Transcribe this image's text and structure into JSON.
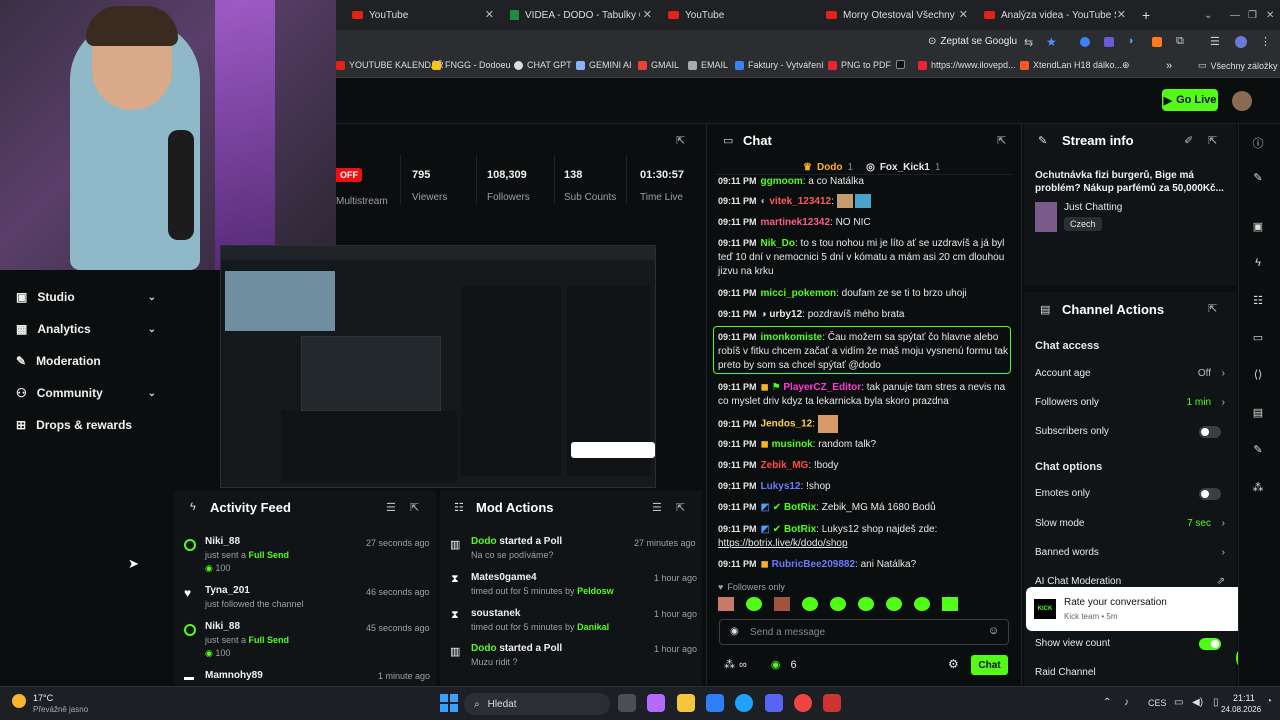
{
  "browser": {
    "tabs": [
      {
        "label": "YouTube",
        "icon": "youtube-icon"
      },
      {
        "label": "VIDEA - DODO - Tabulky Goog",
        "icon": "sheets-icon"
      },
      {
        "label": "YouTube",
        "icon": "youtube-icon"
      },
      {
        "label": "Morry Otestoval Všechny Věc",
        "icon": "youtube-icon"
      },
      {
        "label": "Analýza videa - YouTube Studio",
        "icon": "youtube-icon"
      }
    ],
    "new_tab": "+",
    "ask_google": "Zeptat se Googlu",
    "bookmarks": [
      "YOUTUBE KALENDÁŘ",
      "FNGG - Dodoeu",
      "CHAT GPT",
      "GEMINI AI",
      "GMAIL",
      "EMAIL",
      "Faktury - Vytváření",
      "PNG to PDF",
      "https://www.ilovepd...",
      "XtendLan H18 dálko..."
    ],
    "all_bookmarks": "Všechny záložky"
  },
  "top": {
    "go_live": "Go Live"
  },
  "nav": {
    "items": [
      {
        "label": "Studio",
        "chevron": true
      },
      {
        "label": "Analytics",
        "chevron": true
      },
      {
        "label": "Moderation",
        "chevron": false
      },
      {
        "label": "Community",
        "chevron": true
      },
      {
        "label": "Drops & rewards",
        "chevron": false
      }
    ]
  },
  "stream": {
    "offline_badge": "OFF",
    "multistream": "Multistream",
    "stats": [
      {
        "value": "795",
        "label": "Viewers"
      },
      {
        "value": "108,309",
        "label": "Followers"
      },
      {
        "value": "138",
        "label": "Sub Counts"
      },
      {
        "value": "01:30:57",
        "label": "Time Live"
      }
    ]
  },
  "chat": {
    "title": "Chat",
    "pinned_users": [
      "Dodo",
      "1",
      "Fox_Kick1",
      "1"
    ],
    "messages": [
      {
        "time": "09:11 PM",
        "user": "ggmoom",
        "color": "#53fc18",
        "text": ": a co Natálka"
      },
      {
        "time": "09:11 PM",
        "user": "vitek_123412",
        "color": "#ff5a5a",
        "text": ":"
      },
      {
        "time": "09:11 PM",
        "user": "martinek12342",
        "color": "#ff5a8a",
        "text": ": NO NIC"
      },
      {
        "time": "09:11 PM",
        "user": "Nik_Do",
        "color": "#53fc18",
        "text": ": to s tou nohou mi je líto ať se uzdravíš a já byl teď 10 dní v nemocnici 5 dní v kómatu a mám asi 20 cm dlouhou jizvu na krku"
      },
      {
        "time": "09:11 PM",
        "user": "micci_pokemon",
        "color": "#53fc18",
        "text": ": doufam ze se ti to brzo uhoji"
      },
      {
        "time": "09:11 PM",
        "user": "urby12",
        "color": "#e8e8e8",
        "text": ": pozdravíš mého brata"
      },
      {
        "time": "09:11 PM",
        "user": "imonkomiste",
        "color": "#53fc18",
        "text": ": Čau možem sa spýtať čo hlavne alebo robíš v fitku chcem začať a vidím že maš moju vysnenú formu tak preto by som sa chcel spýtať @dodo"
      },
      {
        "time": "09:11 PM",
        "user": "PlayerCZ_Editor",
        "color": "#ff3ad0",
        "text": ": tak panuje tam stres a nevis na co myslet driv kdyz ta lekarnicka byla skoro prazdna"
      },
      {
        "time": "09:11 PM",
        "user": "Jendos_12",
        "color": "#ffd23f",
        "text": ":"
      },
      {
        "time": "09:11 PM",
        "user": "musinok",
        "color": "#53fc18",
        "text": ": random talk?"
      },
      {
        "time": "09:11 PM",
        "user": "Zebik_MG",
        "color": "#ff4a4a",
        "text": ": !body"
      },
      {
        "time": "09:11 PM",
        "user": "Lukys12",
        "color": "#6b7bff",
        "text": ": !shop"
      },
      {
        "time": "09:11 PM",
        "user": "BotRix",
        "color": "#53fc18",
        "text": ": Zebik_MG Má 1680 Bodů"
      },
      {
        "time": "09:11 PM",
        "user": "BotRix",
        "color": "#53fc18",
        "text": ": Lukys12 shop najdeš zde:"
      },
      {
        "time": "",
        "user": "",
        "color": "#e8e8e8",
        "text": "https://botrix.live/k/dodo/shop"
      },
      {
        "time": "09:11 PM",
        "user": "RubricBee209882",
        "color": "#6b7bff",
        "text": ": ani Natálka?"
      }
    ],
    "followers_only": "Followers only",
    "placeholder": "Send a message",
    "infinity": "∞",
    "points": "6",
    "send": "Chat"
  },
  "stream_info": {
    "title": "Stream info",
    "stream_title": "Ochutnávka fizi burgerů, Bige má problém? Nákup parfémů za 50,000Kč...",
    "category": "Just Chatting",
    "tag": "Czech"
  },
  "channel_actions": {
    "title": "Channel Actions",
    "chat_access": "Chat access",
    "account_age": {
      "label": "Account age",
      "value": "Off"
    },
    "followers_only": {
      "label": "Followers only",
      "value": "1 min"
    },
    "subscribers_only": {
      "label": "Subscribers only",
      "on": false
    },
    "chat_options": "Chat options",
    "emotes_only": {
      "label": "Emotes only",
      "on": false
    },
    "slow_mode": {
      "label": "Slow mode",
      "value": "7 sec"
    },
    "banned_words": "Banned words",
    "ai_moderation": "AI Chat Moderation",
    "show_view_count": {
      "label": "Show view count",
      "on": true
    },
    "raid_channel": "Raid Channel"
  },
  "toast": {
    "title": "Rate your conversation",
    "sub": "Kick team • 5m",
    "brand": "KICK"
  },
  "activity_feed": {
    "title": "Activity Feed",
    "items": [
      {
        "name": "Niki_88",
        "sub": "just sent a",
        "highlight": "Full Send",
        "amount": "100",
        "time": "27 seconds ago"
      },
      {
        "name": "Tyna_201",
        "sub": "just followed the channel",
        "highlight": "",
        "amount": "",
        "time": "46 seconds ago"
      },
      {
        "name": "Niki_88",
        "sub": "just sent a",
        "highlight": "Full Send",
        "amount": "100",
        "time": "45 seconds ago"
      },
      {
        "name": "Mamnohy89",
        "sub": "",
        "highlight": "",
        "amount": "",
        "time": "1 minute ago"
      }
    ]
  },
  "mod_actions": {
    "title": "Mod Actions",
    "items": [
      {
        "name": "Dodo",
        "action": "started a Poll",
        "sub": "Na co se podíváme?",
        "by": "",
        "time": "27 minutes ago"
      },
      {
        "name": "Mates0game4",
        "action": "",
        "sub": "timed out for 5 minutes by",
        "by": "Peldosw",
        "time": "1 hour ago"
      },
      {
        "name": "soustanek",
        "action": "",
        "sub": "timed out for 5 minutes by",
        "by": "Danikal",
        "time": "1 hour ago"
      },
      {
        "name": "Dodo",
        "action": "started a Poll",
        "sub": "Muzu ridit ?",
        "by": "",
        "time": "1 hour ago"
      }
    ]
  },
  "taskbar": {
    "weather_temp": "17°C",
    "weather_text": "Převážně jasno",
    "search": "Hledat",
    "lang": "CES",
    "time": "21:11",
    "date": "24.08.2026"
  },
  "colors": {
    "accent": "#53fc18",
    "bg": "#0b0e0f",
    "panel": "#111417"
  }
}
